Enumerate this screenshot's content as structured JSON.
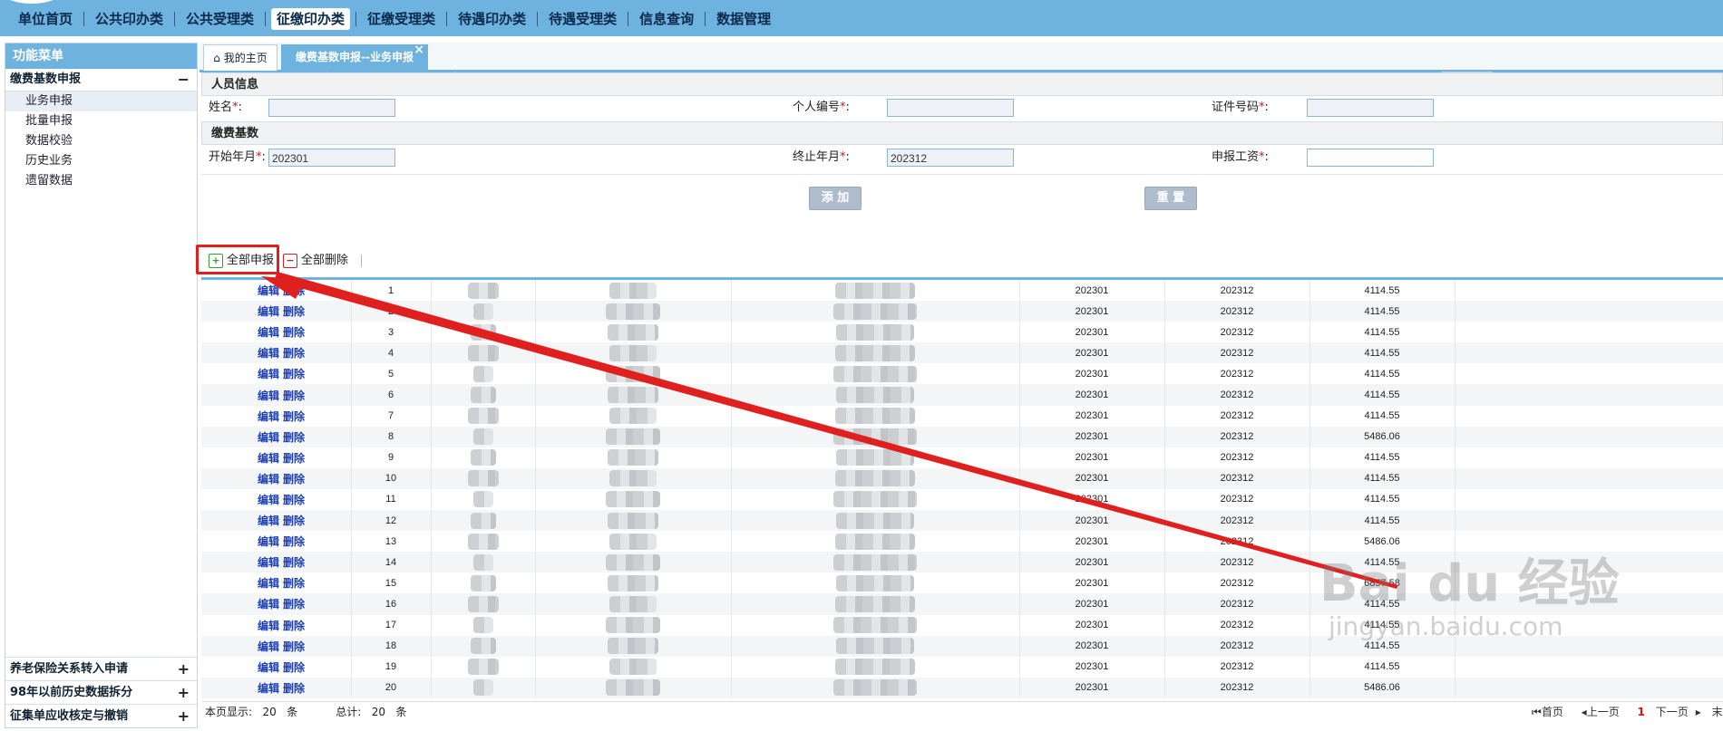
{
  "topnav": {
    "items": [
      "单位首页",
      "公共印办类",
      "公共受理类",
      "征缴印办类",
      "征缴受理类",
      "待遇印办类",
      "待遇受理类",
      "信息查询",
      "数据管理"
    ],
    "active_index": 3
  },
  "sidebar": {
    "title": "功能菜单",
    "group_main": {
      "label": "缴费基数申报",
      "sign": "−"
    },
    "items": [
      "业务申报",
      "批量申报",
      "数据校验",
      "历史业务",
      "遗留数据"
    ],
    "active_index": 0,
    "bottom_groups": [
      {
        "label": "养老保险关系转入申请",
        "sign": "+"
      },
      {
        "label": "98年以前历史数据拆分",
        "sign": "+"
      },
      {
        "label": "征集单应收核定与撤销",
        "sign": "+"
      }
    ]
  },
  "tabs": {
    "home": "我的主页",
    "current": "缴费基数申报--业务申报",
    "close": "×"
  },
  "form": {
    "section_person": "人员信息",
    "name_label": "姓名",
    "person_no_label": "个人编号",
    "id_no_label": "证件号码",
    "section_base": "缴费基数",
    "start_label": "开始年月",
    "start_value": "202301",
    "end_label": "终止年月",
    "end_value": "202312",
    "salary_label": "申报工资",
    "required_mark": "*",
    "colon": ":",
    "add_button": "添 加",
    "reset_button": "重 置"
  },
  "toolbar": {
    "submit_all": "全部申报",
    "delete_all": "全部删除"
  },
  "grid": {
    "edit_label": "编辑",
    "delete_label": "删除",
    "rows": [
      {
        "no": "1",
        "start": "202301",
        "end": "202312",
        "salary": "4114.55"
      },
      {
        "no": "2",
        "start": "202301",
        "end": "202312",
        "salary": "4114.55"
      },
      {
        "no": "3",
        "start": "202301",
        "end": "202312",
        "salary": "4114.55"
      },
      {
        "no": "4",
        "start": "202301",
        "end": "202312",
        "salary": "4114.55"
      },
      {
        "no": "5",
        "start": "202301",
        "end": "202312",
        "salary": "4114.55"
      },
      {
        "no": "6",
        "start": "202301",
        "end": "202312",
        "salary": "4114.55"
      },
      {
        "no": "7",
        "start": "202301",
        "end": "202312",
        "salary": "4114.55"
      },
      {
        "no": "8",
        "start": "202301",
        "end": "202312",
        "salary": "5486.06"
      },
      {
        "no": "9",
        "start": "202301",
        "end": "202312",
        "salary": "4114.55"
      },
      {
        "no": "10",
        "start": "202301",
        "end": "202312",
        "salary": "4114.55"
      },
      {
        "no": "11",
        "start": "202301",
        "end": "202312",
        "salary": "4114.55"
      },
      {
        "no": "12",
        "start": "202301",
        "end": "202312",
        "salary": "4114.55"
      },
      {
        "no": "13",
        "start": "202301",
        "end": "202312",
        "salary": "5486.06"
      },
      {
        "no": "14",
        "start": "202301",
        "end": "202312",
        "salary": "4114.55"
      },
      {
        "no": "15",
        "start": "202301",
        "end": "202312",
        "salary": "6857.58"
      },
      {
        "no": "16",
        "start": "202301",
        "end": "202312",
        "salary": "4114.55"
      },
      {
        "no": "17",
        "start": "202301",
        "end": "202312",
        "salary": "4114.55"
      },
      {
        "no": "18",
        "start": "202301",
        "end": "202312",
        "salary": "4114.55"
      },
      {
        "no": "19",
        "start": "202301",
        "end": "202312",
        "salary": "4114.55"
      },
      {
        "no": "20",
        "start": "202301",
        "end": "202312",
        "salary": "5486.06"
      }
    ]
  },
  "footer": {
    "page_count_label": "本页显示:",
    "page_count": "20",
    "unit": "条",
    "total_label": "总计:",
    "total": "20",
    "first": "首页",
    "prev": "上一页",
    "current_page": "1",
    "next": "下一页",
    "last": "末页"
  },
  "watermark": {
    "brand": "Bai du 经验",
    "url": "jingyan.baidu.com"
  },
  "colors": {
    "nav_blue": "#6eb2e0",
    "highlight_red": "#e0201e",
    "link_blue": "#1c3fb5"
  }
}
